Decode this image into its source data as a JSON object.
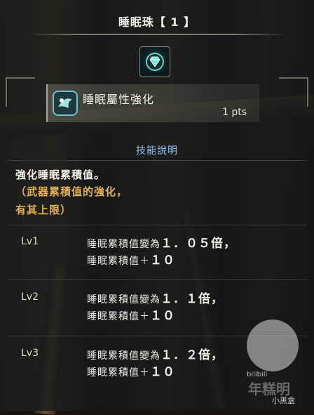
{
  "header": {
    "title": "睡眠珠【 1 】"
  },
  "decoration": {
    "gem_icon": "diamond-gem-icon",
    "skill_icon": "skill-emblem-icon"
  },
  "skill": {
    "name": "睡眠屬性強化",
    "points": "1 pts"
  },
  "description": {
    "section_title": "技能說明",
    "main": "強化睡眠累積值。",
    "note_line1": "（武器累積值的強化，",
    "note_line2": "有其上限）"
  },
  "levels": [
    {
      "label": "Lv1",
      "line1_prefix": "睡眠累積值變為",
      "line1_value": "１．０５倍，",
      "line2_prefix": "睡眠累積值＋",
      "line2_value": "１０"
    },
    {
      "label": "Lv2",
      "line1_prefix": "睡眠累積值變為",
      "line1_value": "１．１倍，",
      "line2_prefix": "睡眠累積值＋",
      "line2_value": "１０"
    },
    {
      "label": "Lv3",
      "line1_prefix": "睡眠累積值變為",
      "line1_value": "１．２倍，",
      "line2_prefix": "睡眠累積值＋",
      "line2_value": "１０"
    }
  ],
  "watermark": {
    "site": "bilibili",
    "author": "年糕明",
    "brand": "小黑盒"
  },
  "colors": {
    "accent_blue": "#8fc2ee",
    "note_gold": "#e0b24a"
  }
}
